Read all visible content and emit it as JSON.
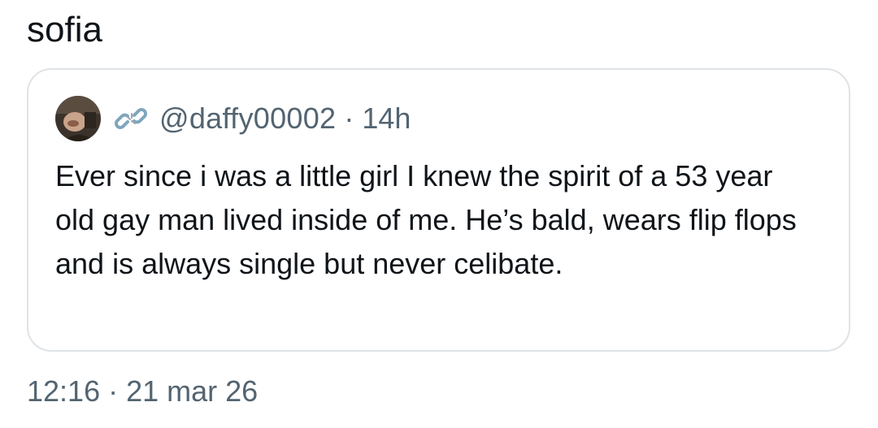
{
  "tweet": {
    "author_name": "sofia",
    "timestamp": "12:16",
    "separator": "·",
    "date": "21 mar 26"
  },
  "quoted_tweet": {
    "handle": "@daffy00002",
    "separator": "·",
    "relative_time": "14h",
    "text": "Ever since i was a little girl I knew the spirit of a 53 year old gay man lived inside of me. He’s bald, wears flip flops and is always single but never celibate.",
    "icons": {
      "avatar": "profile-photo",
      "badge": "chain-link-icon"
    }
  },
  "colors": {
    "text_primary": "#0f1419",
    "text_secondary": "#536471",
    "card_border": "#dfe3e6",
    "link_icon": "#7fa6bd"
  }
}
